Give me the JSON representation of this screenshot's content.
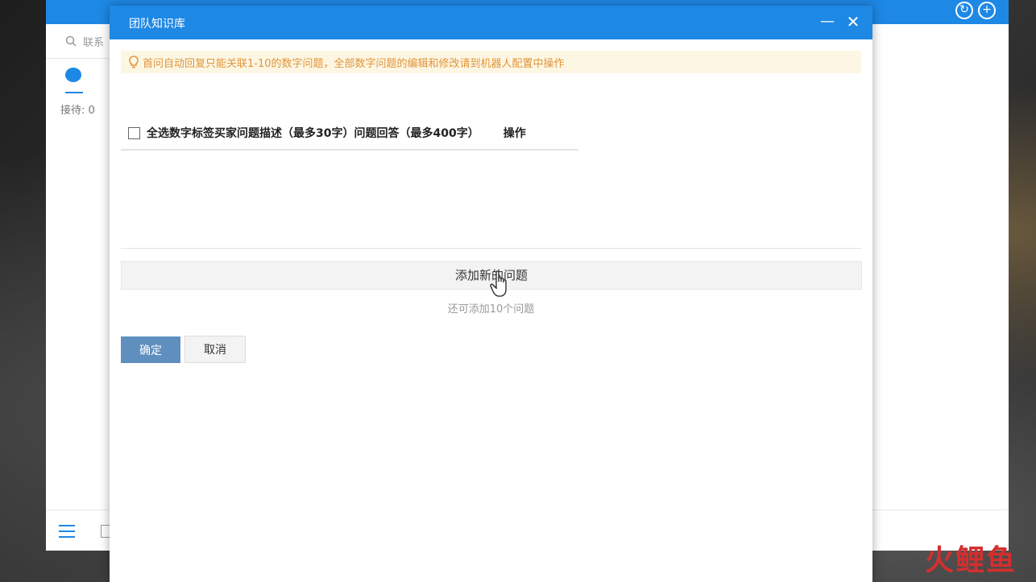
{
  "background_app": {
    "search_placeholder": "联系",
    "reception_status": "接待: 0"
  },
  "dialog": {
    "title": "团队知识库",
    "minimize_symbol": "—",
    "close_symbol": "✕",
    "notice": "首问自动回复只能关联1-10的数字问题，全部数字问题的编辑和修改请到机器人配置中操作",
    "table_header": {
      "columns_text": "全选数字标签买家问题描述（最多30字）问题回答（最多400字）",
      "operations": "操作"
    },
    "add_question_label": "添加新的问题",
    "remaining_hint": "还可添加10个问题",
    "confirm_label": "确定",
    "cancel_label": "取消"
  },
  "watermark": {
    "text": "火鲤鱼"
  },
  "colors": {
    "accent": "#1e88e5",
    "notice_bg": "#fdf6e3",
    "notice_text": "#e0953a",
    "confirm_bg": "#5f8fbf"
  }
}
